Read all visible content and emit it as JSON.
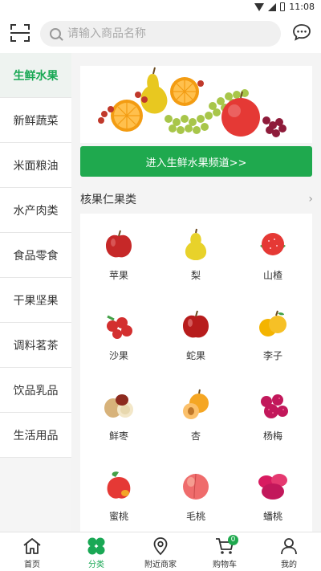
{
  "status_bar": {
    "time": "11:08"
  },
  "search": {
    "placeholder": "请输入商品名称"
  },
  "sidebar": {
    "items": [
      {
        "label": "生鲜水果",
        "active": true
      },
      {
        "label": "新鲜蔬菜"
      },
      {
        "label": "米面粮油"
      },
      {
        "label": "水产肉类"
      },
      {
        "label": "食品零食"
      },
      {
        "label": "干果坚果"
      },
      {
        "label": "调料茗茶"
      },
      {
        "label": "饮品乳品"
      },
      {
        "label": "生活用品"
      }
    ]
  },
  "main": {
    "enter_button": "进入生鲜水果频道>>",
    "section_title": "核果仁果类",
    "section_arrow": "›",
    "products": [
      {
        "name": "苹果",
        "icon": "apple-icon",
        "color": "#c62828"
      },
      {
        "name": "梨",
        "icon": "pear-icon",
        "color": "#e8d22a"
      },
      {
        "name": "山楂",
        "icon": "hawthorn-icon",
        "color": "#e53935"
      },
      {
        "name": "沙果",
        "icon": "crabapple-icon",
        "color": "#d32f2f"
      },
      {
        "name": "蛇果",
        "icon": "red-apple-icon",
        "color": "#b71c1c"
      },
      {
        "name": "李子",
        "icon": "plum-icon",
        "color": "#f4b400"
      },
      {
        "name": "鲜枣",
        "icon": "jujube-icon",
        "color": "#e8c58a"
      },
      {
        "name": "杏",
        "icon": "apricot-icon",
        "color": "#f5a623"
      },
      {
        "name": "杨梅",
        "icon": "bayberry-icon",
        "color": "#c2185b"
      },
      {
        "name": "蜜桃",
        "icon": "peach-icon",
        "color": "#e53935"
      },
      {
        "name": "毛桃",
        "icon": "fuzzy-peach-icon",
        "color": "#ef6c6c"
      },
      {
        "name": "蟠桃",
        "icon": "flat-peach-icon",
        "color": "#d81b60"
      }
    ]
  },
  "bottom_nav": {
    "tabs": [
      {
        "label": "首页",
        "icon": "home-icon"
      },
      {
        "label": "分类",
        "icon": "category-icon",
        "active": true
      },
      {
        "label": "附近商家",
        "icon": "location-icon"
      },
      {
        "label": "购物车",
        "icon": "cart-icon",
        "badge": "0"
      },
      {
        "label": "我的",
        "icon": "user-icon"
      }
    ]
  },
  "colors": {
    "accent": "#1fa94e",
    "active_text": "#1aa855"
  }
}
